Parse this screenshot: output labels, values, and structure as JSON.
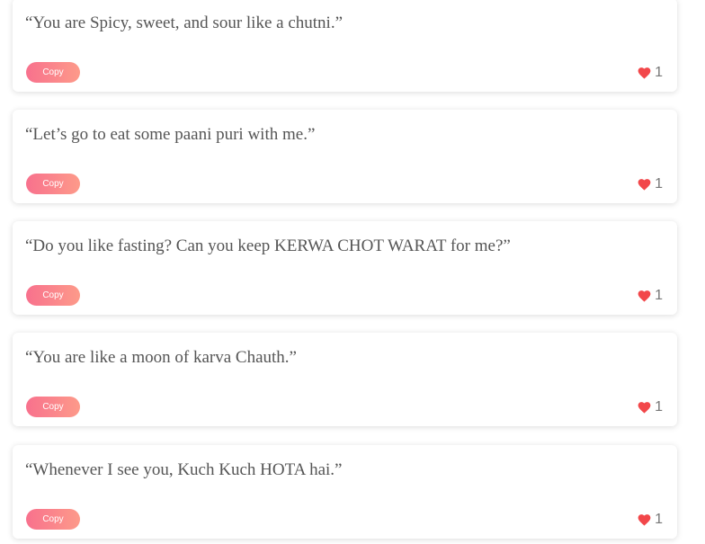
{
  "colors": {
    "accent_start": "#f8718d",
    "accent_end": "#fd9a8a",
    "heart": "#f2474a",
    "quote_text": "#555555"
  },
  "quotes": [
    {
      "text": "“You are Spicy, sweet, and sour like a chutni.”",
      "copy_label": "Copy",
      "likes": "1",
      "heart_icon": "heart-icon"
    },
    {
      "text": "“Let’s go to eat some paani puri with me.”",
      "copy_label": "Copy",
      "likes": "1",
      "heart_icon": "heart-icon"
    },
    {
      "text": "“Do you like fasting? Can you keep KERWA CHOT WARAT for me?”",
      "copy_label": "Copy",
      "likes": "1",
      "heart_icon": "heart-icon"
    },
    {
      "text": "“You are like a moon of karva Chauth.”",
      "copy_label": "Copy",
      "likes": "1",
      "heart_icon": "heart-icon"
    },
    {
      "text": "“Whenever I see you, Kuch Kuch HOTA hai.”",
      "copy_label": "Copy",
      "likes": "1",
      "heart_icon": "heart-icon"
    }
  ]
}
